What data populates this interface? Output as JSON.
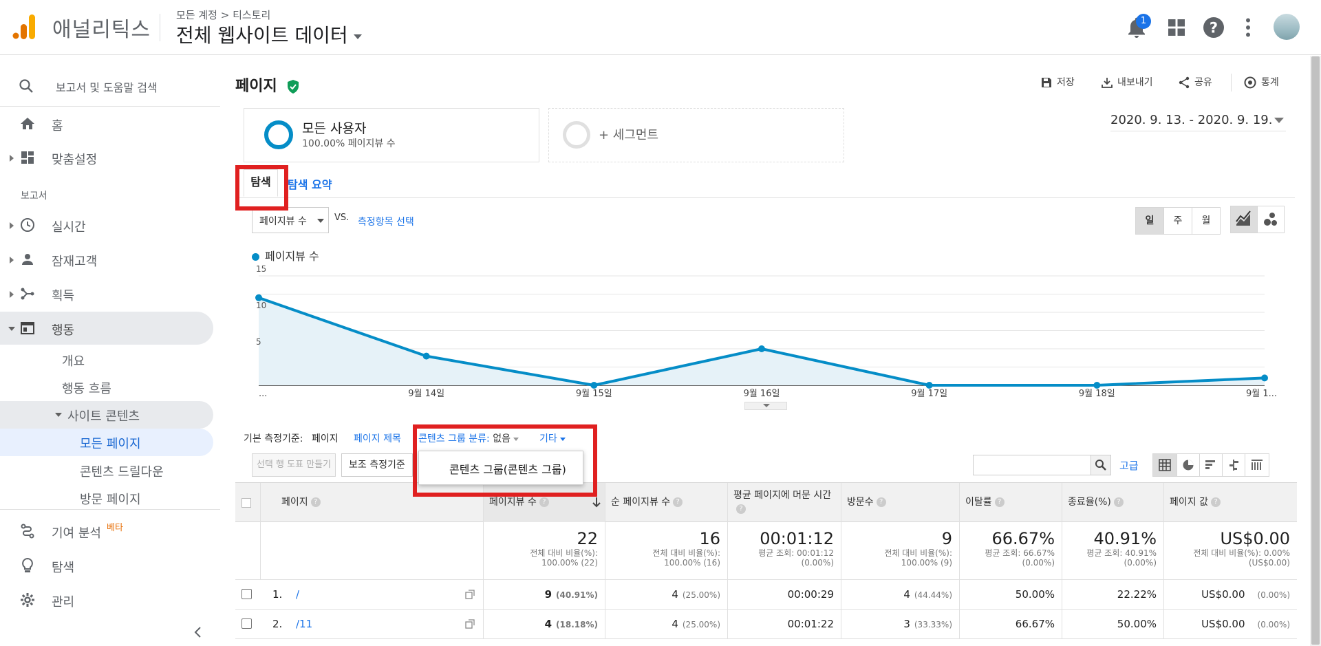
{
  "app": {
    "name": "애널리틱스",
    "breadcrumb": "모든 계정 > 티스토리",
    "view_title": "전체 웹사이트 데이터",
    "notification_count": "1"
  },
  "sidebar": {
    "search_placeholder": "보고서 및 도움말 검색",
    "home": "홈",
    "customization": "맞춤설정",
    "reports_section": "보고서",
    "realtime": "실시간",
    "audience": "잠재고객",
    "acquisition": "획득",
    "behavior": "행동",
    "behavior_overview": "개요",
    "behavior_flow": "행동 흐름",
    "site_content": "사이트 콘텐츠",
    "all_pages": "모든 페이지",
    "content_drilldown": "콘텐츠 드릴다운",
    "landing_pages": "방문 페이지",
    "attribution": "기여 분석",
    "attribution_badge": "베타",
    "discover": "탐색",
    "admin": "관리"
  },
  "main": {
    "title": "페이지",
    "actions": {
      "save": "저장",
      "export": "내보내기",
      "share": "공유",
      "insights": "통계"
    },
    "segment": {
      "name": "모든 사용자",
      "desc": "100.00% 페이지뷰 수",
      "add": "+ 세그먼트"
    },
    "date_range": "2020. 9. 13. - 2020. 9. 19.",
    "tabs": {
      "explorer": "탐색",
      "explorer_summary": "탐색 요약"
    },
    "metric_select": "페이지뷰 수",
    "vs": "VS.",
    "select_metric": "측정항목 선택",
    "period_buttons": [
      "일",
      "주",
      "월"
    ],
    "primary_dimension_label": "기본 측정기준:",
    "dimensions": {
      "page": "페이지",
      "page_title": "페이지 제목",
      "content_grouping": "콘텐츠 그룹 분류:",
      "content_grouping_value": "없음",
      "other": "기타"
    },
    "dropdown_item": "콘텐츠 그룹(콘텐츠 그룹)",
    "plot_rows_button": "선택 행 도표 만들기",
    "secondary_dimension": "보조 측정기준",
    "advanced": "고급"
  },
  "chart_data": {
    "type": "line",
    "series": [
      {
        "name": "페이지뷰 수",
        "values": [
          12,
          4,
          0,
          5,
          0,
          0,
          1
        ]
      }
    ],
    "x": [
      "...",
      "9월 14일",
      "9월 15일",
      "9월 16일",
      "9월 17일",
      "9월 18일",
      "9월 1..."
    ],
    "y_ticks": [
      "15",
      "10",
      "5"
    ],
    "ylim": [
      0,
      15
    ],
    "color": "#058dc7"
  },
  "table": {
    "headers": [
      "페이지",
      "페이지뷰 수",
      "순 페이지뷰 수",
      "평균 페이지에 머문 시간",
      "방문수",
      "이탈률",
      "종료율(%)",
      "페이지 값"
    ],
    "totals": [
      {
        "big": "22",
        "l1": "전체 대비 비율(%):",
        "l2": "100.00% (22)"
      },
      {
        "big": "16",
        "l1": "전체 대비 비율(%):",
        "l2": "100.00% (16)"
      },
      {
        "big": "00:01:12",
        "l1": "평균 조회: 00:01:12",
        "l2": "(0.00%)"
      },
      {
        "big": "9",
        "l1": "전체 대비 비율(%):",
        "l2": "100.00% (9)"
      },
      {
        "big": "66.67%",
        "l1": "평균 조회: 66.67%",
        "l2": "(0.00%)"
      },
      {
        "big": "40.91%",
        "l1": "평균 조회: 40.91%",
        "l2": "(0.00%)"
      },
      {
        "big": "US$0.00",
        "l1": "전체 대비 비율(%): 0.00%",
        "l2": "(US$0.00)"
      }
    ],
    "rows": [
      {
        "num": "1.",
        "page": "/",
        "pv": "9",
        "pv_pct": "(40.91%)",
        "upv": "4",
        "upv_pct": "(25.00%)",
        "time": "00:00:29",
        "ent": "4",
        "ent_pct": "(44.44%)",
        "bounce": "50.00%",
        "exit": "22.22%",
        "val": "US$0.00",
        "val_pct": "(0.00%)"
      },
      {
        "num": "2.",
        "page": "/11",
        "pv": "4",
        "pv_pct": "(18.18%)",
        "upv": "4",
        "upv_pct": "(25.00%)",
        "time": "00:01:22",
        "ent": "3",
        "ent_pct": "(33.33%)",
        "bounce": "66.67%",
        "exit": "50.00%",
        "val": "US$0.00",
        "val_pct": "(0.00%)"
      }
    ]
  }
}
